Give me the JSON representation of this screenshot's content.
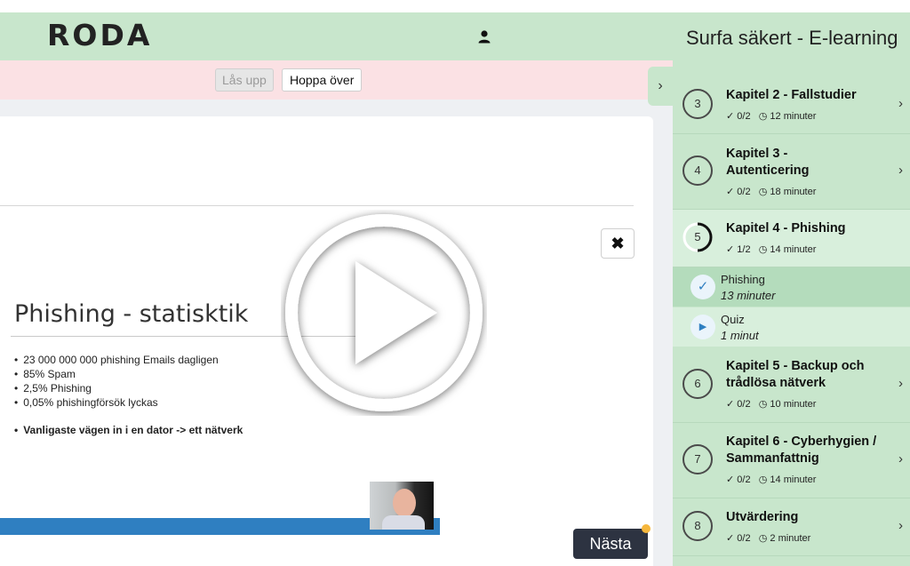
{
  "header": {
    "logo": "RODA",
    "user_icon": "user-icon"
  },
  "toolbar": {
    "unlock_label": "Lås upp",
    "skip_label": "Hoppa över"
  },
  "slide": {
    "title": "Phishing - statisktik",
    "bullets": [
      "23  000 000 000 phishing Emails dagligen",
      "85%  Spam",
      "2,5%  Phishing",
      "0,05% phishingförsök lyckas"
    ],
    "bold_bullet": "Vanligaste vägen in i en dator -> ett nätverk",
    "close_label": "✖"
  },
  "player": {
    "next_label": "Nästa"
  },
  "sidebar": {
    "toggle_label": "›",
    "course_title": "Surfa säkert - E-learning",
    "chapters": [
      {
        "number": "3",
        "title": "Kapitel 2 - Fallstudier",
        "progress": "✓ 0/2",
        "duration": "12 minuter"
      },
      {
        "number": "4",
        "title": "Kapitel 3 - Autenticering",
        "progress": "✓ 0/2",
        "duration": "18 minuter"
      },
      {
        "number": "5",
        "title": "Kapitel 4 - Phishing",
        "progress": "✓ 1/2",
        "duration": "14 minuter"
      },
      {
        "number": "6",
        "title": "Kapitel 5 - Backup och trådlösa nätverk",
        "progress": "✓ 0/2",
        "duration": "10 minuter"
      },
      {
        "number": "7",
        "title": "Kapitel 6 - Cyberhygien / Sammanfattnig",
        "progress": "✓ 0/2",
        "duration": "14 minuter"
      },
      {
        "number": "8",
        "title": "Utvärdering",
        "progress": "✓ 0/2",
        "duration": "2 minuter"
      }
    ],
    "lessons": [
      {
        "name": "Phishing",
        "duration": "13 minuter"
      },
      {
        "name": "Quiz",
        "duration": "1 minut"
      }
    ]
  }
}
